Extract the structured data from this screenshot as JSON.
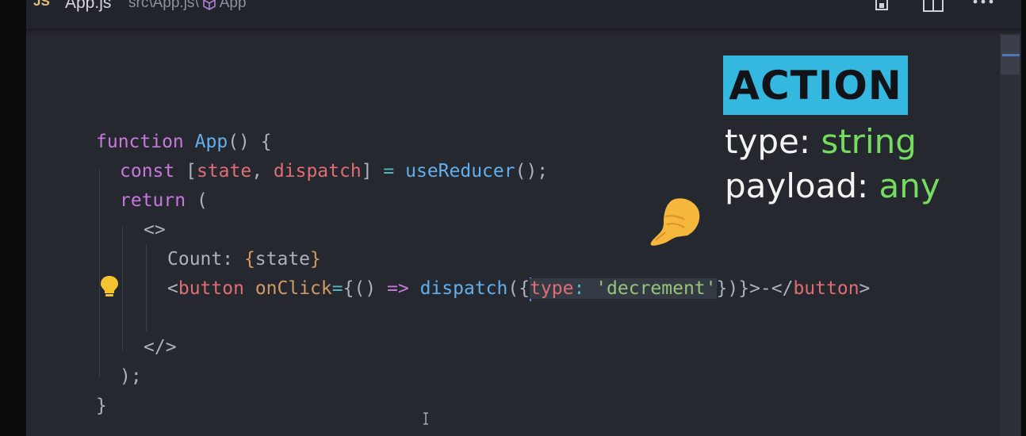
{
  "tab": {
    "lang_badge": "JS",
    "file_name": "App.js",
    "breadcrumb_path": "src\\App.js\\",
    "breadcrumb_symbol": "App"
  },
  "code": {
    "line1": [
      "function",
      "App",
      "() {"
    ],
    "line2": [
      "const",
      "[",
      "state",
      ", ",
      "dispatch",
      "] ",
      "=",
      " ",
      "useReducer",
      "();"
    ],
    "line3": [
      "return",
      " ("
    ],
    "line4": "<>",
    "line5": [
      "Count: ",
      "{",
      "state",
      "}"
    ],
    "line6": [
      "<",
      "button",
      " ",
      "onClick",
      "=",
      "{",
      "()",
      " ",
      "=>",
      " ",
      "dispatch",
      "({",
      "type",
      ":",
      " ",
      "'decrement'",
      "})}",
      ">-</",
      "button",
      ">"
    ],
    "line8": "</>",
    "line9": ");",
    "line10": "}"
  },
  "annotation": {
    "title": "ACTION",
    "type_label": "type: ",
    "type_value": "string",
    "payload_label": "payload: ",
    "payload_value": "any"
  },
  "icons": [
    "js-file-icon",
    "symbol-cube-icon",
    "copy-icon",
    "split-editor-icon",
    "more-icon",
    "lightbulb-icon",
    "pointing-hand-icon",
    "text-cursor-icon"
  ],
  "colors": {
    "keyword": "#c678dd",
    "function": "#61afef",
    "variable": "#e06c75",
    "string": "#98c379",
    "annotation_accent": "#35b8df",
    "annotation_value": "#74dc5e"
  }
}
